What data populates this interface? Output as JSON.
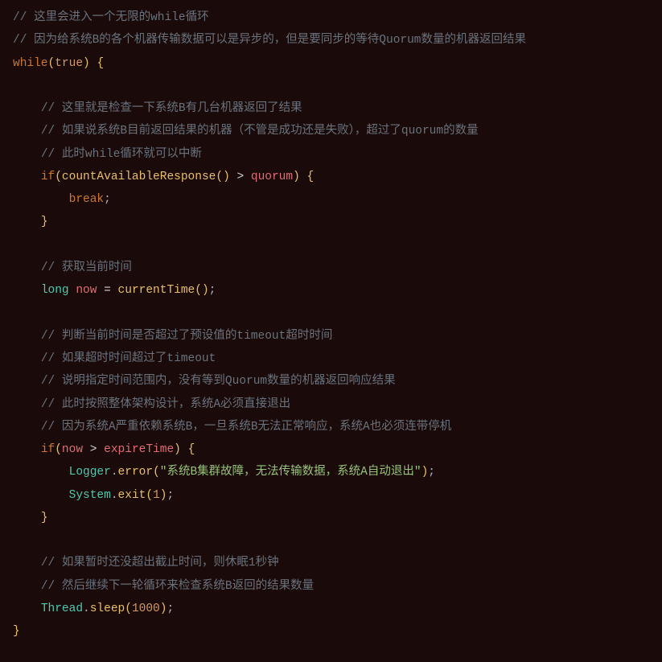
{
  "code": {
    "lines": [
      {
        "indent": 0,
        "tokens": [
          {
            "t": "// 这里会进入一个无限的while循环",
            "c": "comment"
          }
        ]
      },
      {
        "indent": 0,
        "tokens": [
          {
            "t": "// 因为给系统B的各个机器传输数据可以是异步的，但是要同步的等待Quorum数量的机器返回结果",
            "c": "comment"
          }
        ]
      },
      {
        "indent": 0,
        "tokens": [
          {
            "t": "while",
            "c": "keyword"
          },
          {
            "t": "(",
            "c": "paren"
          },
          {
            "t": "true",
            "c": "bool"
          },
          {
            "t": ")",
            "c": "paren"
          },
          {
            "t": " ",
            "c": "op"
          },
          {
            "t": "{",
            "c": "brace"
          }
        ]
      },
      {
        "indent": 0,
        "tokens": []
      },
      {
        "indent": 1,
        "tokens": [
          {
            "t": "// 这里就是检查一下系统B有几台机器返回了结果",
            "c": "comment"
          }
        ]
      },
      {
        "indent": 1,
        "tokens": [
          {
            "t": "// 如果说系统B目前返回结果的机器（不管是成功还是失败），超过了quorum的数量",
            "c": "comment"
          }
        ]
      },
      {
        "indent": 1,
        "tokens": [
          {
            "t": "// 此时while循环就可以中断",
            "c": "comment"
          }
        ]
      },
      {
        "indent": 1,
        "tokens": [
          {
            "t": "if",
            "c": "keyword"
          },
          {
            "t": "(",
            "c": "paren"
          },
          {
            "t": "countAvailableResponse",
            "c": "func"
          },
          {
            "t": "(",
            "c": "paren"
          },
          {
            "t": ")",
            "c": "paren"
          },
          {
            "t": " > ",
            "c": "op"
          },
          {
            "t": "quorum",
            "c": "ident"
          },
          {
            "t": ")",
            "c": "paren"
          },
          {
            "t": " ",
            "c": "op"
          },
          {
            "t": "{",
            "c": "brace"
          }
        ]
      },
      {
        "indent": 2,
        "tokens": [
          {
            "t": "break",
            "c": "keyword"
          },
          {
            "t": ";",
            "c": "punct"
          }
        ]
      },
      {
        "indent": 1,
        "tokens": [
          {
            "t": "}",
            "c": "brace"
          }
        ]
      },
      {
        "indent": 0,
        "tokens": []
      },
      {
        "indent": 1,
        "tokens": [
          {
            "t": "// 获取当前时间",
            "c": "comment"
          }
        ]
      },
      {
        "indent": 1,
        "tokens": [
          {
            "t": "long",
            "c": "type"
          },
          {
            "t": " ",
            "c": "op"
          },
          {
            "t": "now",
            "c": "var"
          },
          {
            "t": " = ",
            "c": "op"
          },
          {
            "t": "currentTime",
            "c": "func"
          },
          {
            "t": "(",
            "c": "paren"
          },
          {
            "t": ")",
            "c": "paren"
          },
          {
            "t": ";",
            "c": "punct"
          }
        ]
      },
      {
        "indent": 0,
        "tokens": []
      },
      {
        "indent": 1,
        "tokens": [
          {
            "t": "// 判断当前时间是否超过了预设值的timeout超时时间",
            "c": "comment"
          }
        ]
      },
      {
        "indent": 1,
        "tokens": [
          {
            "t": "// 如果超时时间超过了timeout",
            "c": "comment"
          }
        ]
      },
      {
        "indent": 1,
        "tokens": [
          {
            "t": "// 说明指定时间范围内，没有等到Quorum数量的机器返回响应结果",
            "c": "comment"
          }
        ]
      },
      {
        "indent": 1,
        "tokens": [
          {
            "t": "// 此时按照整体架构设计，系统A必须直接退出",
            "c": "comment"
          }
        ]
      },
      {
        "indent": 1,
        "tokens": [
          {
            "t": "// 因为系统A严重依赖系统B，一旦系统B无法正常响应，系统A也必须连带停机",
            "c": "comment"
          }
        ]
      },
      {
        "indent": 1,
        "tokens": [
          {
            "t": "if",
            "c": "keyword"
          },
          {
            "t": "(",
            "c": "paren"
          },
          {
            "t": "now",
            "c": "ident"
          },
          {
            "t": " > ",
            "c": "op"
          },
          {
            "t": "expireTime",
            "c": "ident"
          },
          {
            "t": ")",
            "c": "paren"
          },
          {
            "t": " ",
            "c": "op"
          },
          {
            "t": "{",
            "c": "brace"
          }
        ]
      },
      {
        "indent": 2,
        "tokens": [
          {
            "t": "Logger",
            "c": "class"
          },
          {
            "t": ".",
            "c": "dot"
          },
          {
            "t": "error",
            "c": "method"
          },
          {
            "t": "(",
            "c": "paren"
          },
          {
            "t": "\"系统B集群故障，无法传输数据，系统A自动退出\"",
            "c": "string"
          },
          {
            "t": ")",
            "c": "paren"
          },
          {
            "t": ";",
            "c": "punct"
          }
        ]
      },
      {
        "indent": 2,
        "tokens": [
          {
            "t": "System",
            "c": "class"
          },
          {
            "t": ".",
            "c": "dot"
          },
          {
            "t": "exit",
            "c": "method"
          },
          {
            "t": "(",
            "c": "paren"
          },
          {
            "t": "1",
            "c": "number"
          },
          {
            "t": ")",
            "c": "paren"
          },
          {
            "t": ";",
            "c": "punct"
          }
        ]
      },
      {
        "indent": 1,
        "tokens": [
          {
            "t": "}",
            "c": "brace"
          }
        ]
      },
      {
        "indent": 0,
        "tokens": []
      },
      {
        "indent": 1,
        "tokens": [
          {
            "t": "// 如果暂时还没超出截止时间，则休眠1秒钟",
            "c": "comment"
          }
        ]
      },
      {
        "indent": 1,
        "tokens": [
          {
            "t": "// 然后继续下一轮循环来检查系统B返回的结果数量",
            "c": "comment"
          }
        ]
      },
      {
        "indent": 1,
        "tokens": [
          {
            "t": "Thread",
            "c": "class"
          },
          {
            "t": ".",
            "c": "dot"
          },
          {
            "t": "sleep",
            "c": "method"
          },
          {
            "t": "(",
            "c": "paren"
          },
          {
            "t": "1000",
            "c": "number"
          },
          {
            "t": ")",
            "c": "paren"
          },
          {
            "t": ";",
            "c": "punct"
          }
        ]
      },
      {
        "indent": 0,
        "tokens": [
          {
            "t": "}",
            "c": "brace"
          }
        ]
      }
    ]
  }
}
